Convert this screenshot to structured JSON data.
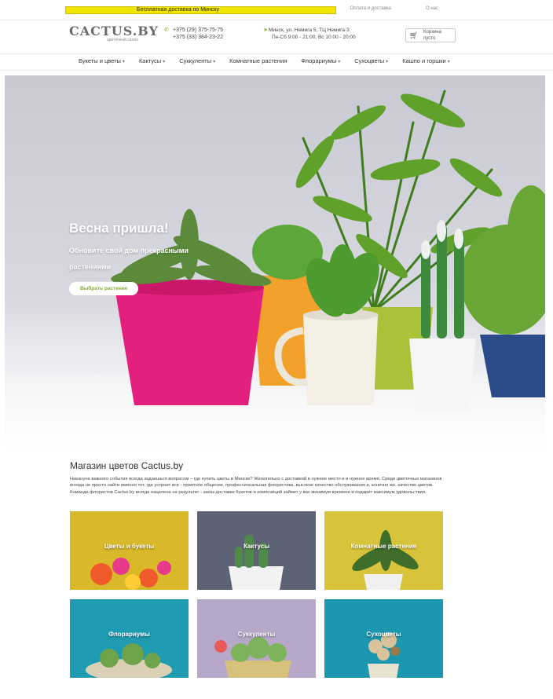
{
  "topbar": {
    "promo_text": "Бесплатная доставка по Минску",
    "link_1": "Оплата и доставка",
    "link_2": "О нас"
  },
  "header": {
    "logo_text": "CACTUS.BY",
    "logo_tagline": "цветочный салон",
    "phone_1": "+375 (29) 375-75-75",
    "phone_2": "+375 (33) 384-23-22",
    "address": "Минск, ул. Немига 5, ТЦ Немига-3",
    "hours": "Пн-Сб 9:00 - 21:00, Вс 10:00 - 20:00",
    "cart_label": "Корзина",
    "cart_value": "пусто"
  },
  "nav": {
    "items": [
      {
        "label": "Букеты и цветы"
      },
      {
        "label": "Кактусы"
      },
      {
        "label": "Суккуленты"
      },
      {
        "label": "Комнатные растения"
      },
      {
        "label": "Флорариумы"
      },
      {
        "label": "Сухоцветы"
      },
      {
        "label": "Кашпо и горшки"
      }
    ]
  },
  "hero": {
    "title": "Весна пришла!",
    "subtitle": "Обновите свой дом прекрасными растениями",
    "button": "Выбрать растение"
  },
  "main": {
    "title": "Магазин цветов Cactus.by",
    "description": "Накануне важного события всегда задаешься вопросом – где купить цветы в Минске? Желательно с доставкой в нужное место и в нужное время. Среди цветочных магазинов иногда не просто найти именно тот, где устроит все - приятное общение, профессиональная флористика, высокое качество обслуживания и, конечно же, качество цветов. Команда флористов Cactus.by всегда нацелена на результат - заказ доставки букетов и композиций займет у вас минимум времени и подарит максимум удовольствия.",
    "tiles": [
      {
        "label": "Цветы и букеты",
        "bg": "#d9b82a"
      },
      {
        "label": "Кактусы",
        "bg": "#5d6275"
      },
      {
        "label": "Комнатные растения",
        "bg": "#d8c43a"
      },
      {
        "label": "Флорариумы",
        "bg": "#1f9bb2"
      },
      {
        "label": "Суккуленты",
        "bg": "#b7a8c9"
      },
      {
        "label": "Сухоцветы",
        "bg": "#1d97b0"
      }
    ]
  },
  "colors": {
    "accent": "#7cb518",
    "pot_pink": "#e3207e",
    "pot_orange": "#f2a22a"
  }
}
